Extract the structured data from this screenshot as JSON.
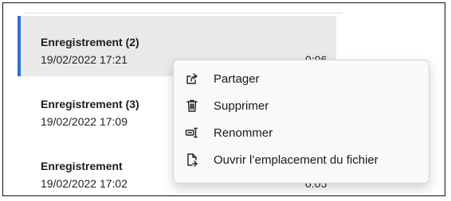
{
  "recordings": [
    {
      "title": "Enregistrement (2)",
      "date": "19/02/2022 17:21",
      "duration": "0:06"
    },
    {
      "title": "Enregistrement (3)",
      "date": "19/02/2022 17:09",
      "duration": ""
    },
    {
      "title": "Enregistrement",
      "date": "19/02/2022 17:02",
      "duration": "0:05"
    }
  ],
  "context_menu": {
    "items": [
      {
        "label": "Partager",
        "icon": "share-icon"
      },
      {
        "label": "Supprimer",
        "icon": "trash-icon"
      },
      {
        "label": "Renommer",
        "icon": "rename-icon"
      },
      {
        "label": "Ouvrir l’emplacement du fichier",
        "icon": "open-file-location-icon"
      }
    ]
  },
  "colors": {
    "selection_accent": "#2f6fd0",
    "selected_row_bg": "#e9e9e9"
  }
}
